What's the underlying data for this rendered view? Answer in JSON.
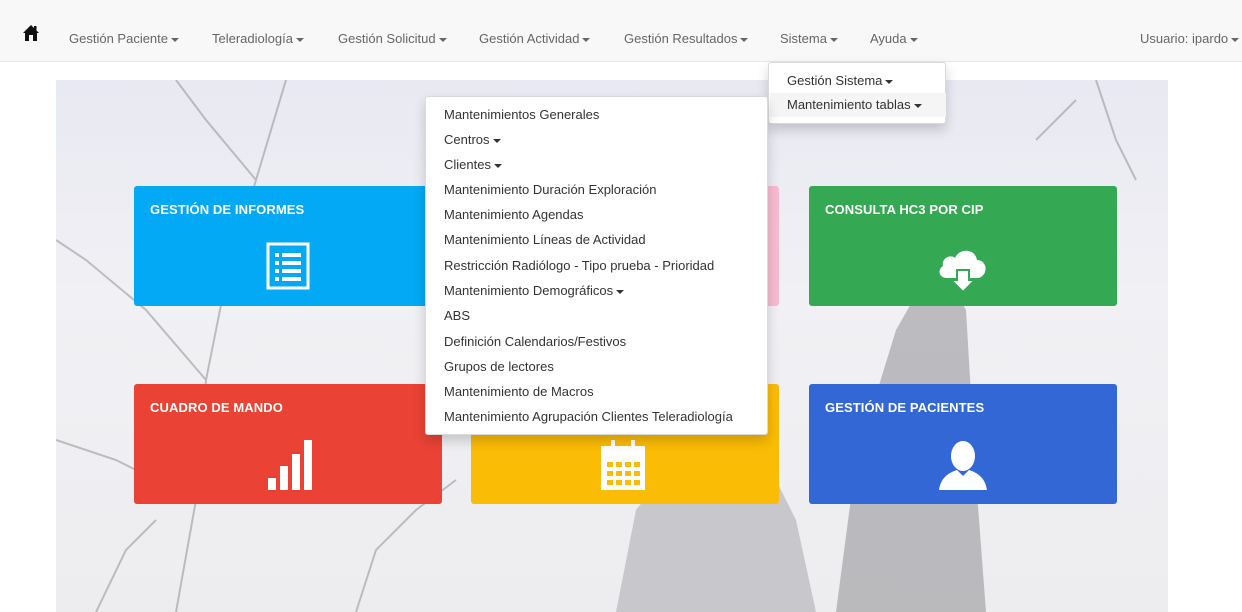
{
  "navbar": {
    "items": [
      {
        "label": "Gestión Paciente"
      },
      {
        "label": "Teleradiología"
      },
      {
        "label": "Gestión Solicitud"
      },
      {
        "label": "Gestión Actividad"
      },
      {
        "label": "Gestión Resultados"
      },
      {
        "label": "Sistema"
      },
      {
        "label": "Ayuda"
      }
    ],
    "user_label": "Usuario: ipardo"
  },
  "sistema_menu": {
    "items": [
      {
        "label": "Gestión Sistema"
      },
      {
        "label": "Mantenimiento tablas"
      }
    ]
  },
  "tablas_menu": {
    "items": [
      {
        "label": "Mantenimientos Generales"
      },
      {
        "label": "Centros"
      },
      {
        "label": "Clientes"
      },
      {
        "label": "Mantenimiento Duración Exploración"
      },
      {
        "label": "Mantenimiento Agendas"
      },
      {
        "label": "Mantenimiento Líneas de Actividad"
      },
      {
        "label": "Restricción Radiólogo - Tipo prueba - Prioridad"
      },
      {
        "label": "Mantenimiento Demográficos"
      },
      {
        "label": "ABS"
      },
      {
        "label": "Definición Calendarios/Festivos"
      },
      {
        "label": "Grupos de lectores"
      },
      {
        "label": "Mantenimiento de Macros"
      },
      {
        "label": "Mantenimiento Agrupación Clientes Teleradiología"
      }
    ]
  },
  "tiles": [
    {
      "title": "GESTIÓN DE INFORMES",
      "color": "#03a9f4",
      "icon": "list-icon"
    },
    {
      "title": "",
      "color": "#f8bbd0",
      "icon": ""
    },
    {
      "title": "CONSULTA HC3 POR CIP",
      "color": "#34a853",
      "icon": "cloud-download-icon"
    },
    {
      "title": "CUADRO DE MANDO",
      "color": "#ea4335",
      "icon": "bar-chart-icon"
    },
    {
      "title": "",
      "color": "#fbbc05",
      "icon": "calendar-icon"
    },
    {
      "title": "GESTIÓN DE PACIENTES",
      "color": "#3367d6",
      "icon": "user-icon"
    }
  ]
}
